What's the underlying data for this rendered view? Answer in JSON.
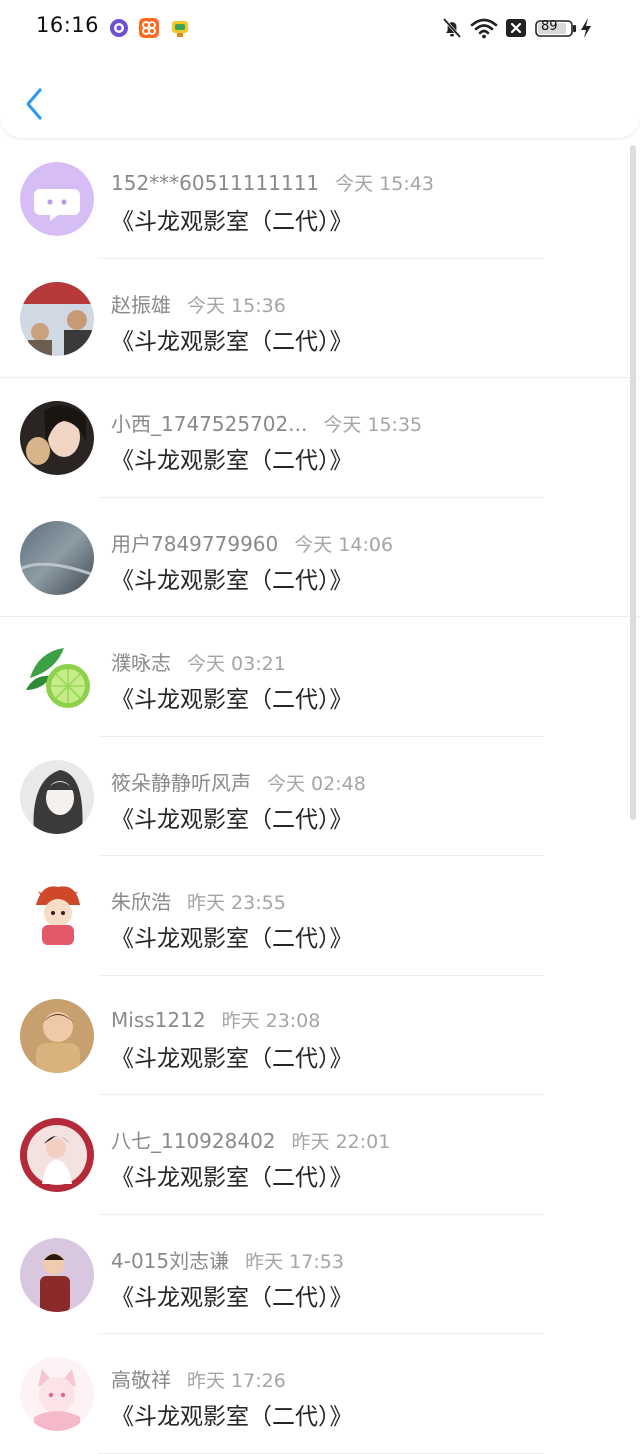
{
  "status_bar": {
    "time": "16:16",
    "battery": "89",
    "apps": [
      "purple-circle-app-icon",
      "orange-app-icon",
      "trophy-app-icon"
    ],
    "icons": [
      "mute-bell-icon",
      "wifi-icon",
      "close-box-icon",
      "battery-icon",
      "charging-bolt-icon"
    ]
  },
  "header": {
    "back_icon": "chevron-left-icon",
    "accent": "#2d9cf0"
  },
  "rows": [
    {
      "name": "152***60511111111",
      "time": "今天 15:43",
      "message": "《斗龙观影室（二代）》"
    },
    {
      "name": "赵振雄",
      "time": "今天 15:36",
      "message": "《斗龙观影室（二代）》"
    },
    {
      "name": "小西_1747525702...",
      "time": "今天 15:35",
      "message": "《斗龙观影室（二代）》"
    },
    {
      "name": "用户7849779960",
      "time": "今天 14:06",
      "message": "《斗龙观影室（二代）》"
    },
    {
      "name": "濮咏志",
      "time": "今天 03:21",
      "message": "《斗龙观影室（二代）》"
    },
    {
      "name": "筱朵静静听风声",
      "time": "今天 02:48",
      "message": "《斗龙观影室（二代）》"
    },
    {
      "name": "朱欣浩",
      "time": "昨天 23:55",
      "message": "《斗龙观影室（二代）》"
    },
    {
      "name": "Miss1212",
      "time": "昨天 23:08",
      "message": "《斗龙观影室（二代）》"
    },
    {
      "name": "八七_110928402",
      "time": "昨天 22:01",
      "message": "《斗龙观影室（二代）》"
    },
    {
      "name": "4-015刘志谦",
      "time": "昨天 17:53",
      "message": "《斗龙观影室（二代）》"
    },
    {
      "name": "高敬祥",
      "time": "昨天 17:26",
      "message": "《斗龙观影室（二代）》"
    }
  ]
}
